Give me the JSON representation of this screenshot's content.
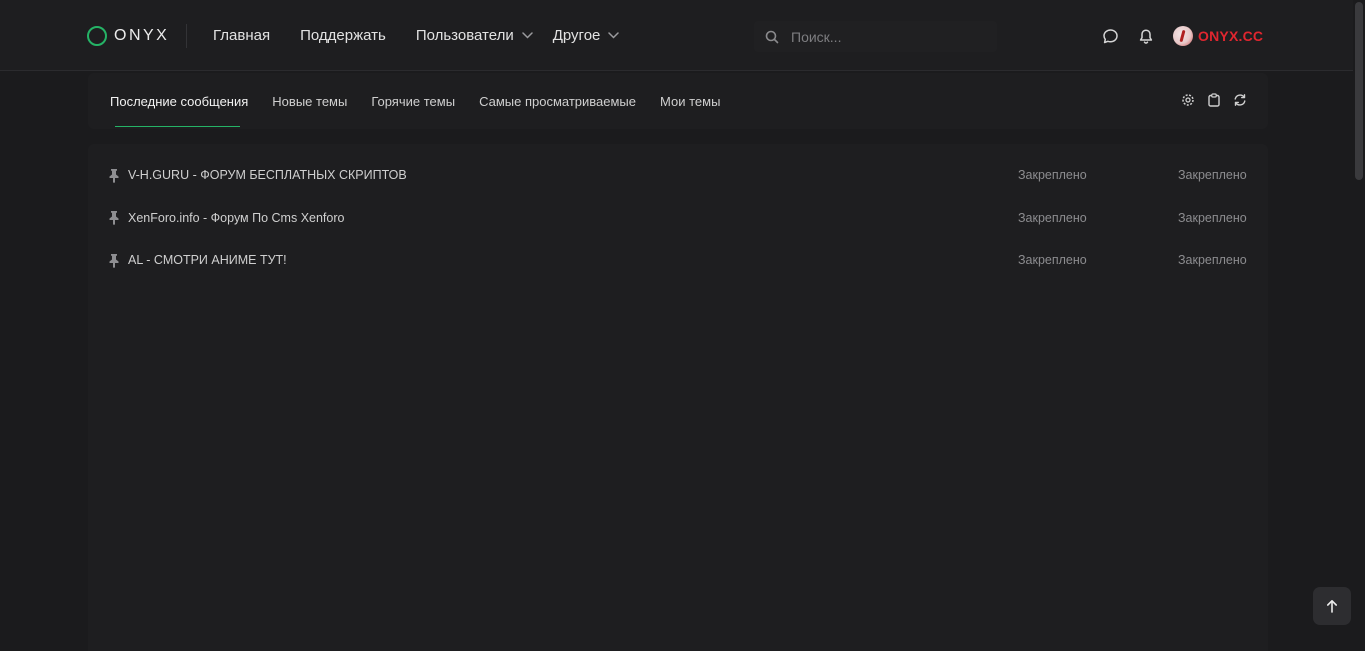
{
  "brand": {
    "name": "ONYX",
    "accent": "#25b366"
  },
  "nav": {
    "items": [
      {
        "label": "Главная",
        "dropdown": false
      },
      {
        "label": "Поддержать",
        "dropdown": false
      },
      {
        "label": "Пользователи",
        "dropdown": true
      },
      {
        "label": "Другое",
        "dropdown": true
      }
    ]
  },
  "search": {
    "placeholder": "Поиск...",
    "value": ""
  },
  "header_icons": [
    "chat-icon",
    "bell-icon"
  ],
  "user": {
    "name": "ONYX.CC",
    "color": "#e0262f"
  },
  "tabs": {
    "items": [
      {
        "label": "Последние сообщения",
        "active": true
      },
      {
        "label": "Новые темы",
        "active": false
      },
      {
        "label": "Горячие темы",
        "active": false
      },
      {
        "label": "Самые просматриваемые",
        "active": false
      },
      {
        "label": "Мои темы",
        "active": false
      }
    ],
    "actions": [
      "settings-icon",
      "clipboard-icon",
      "refresh-icon"
    ]
  },
  "threads": [
    {
      "title": "V-H.GURU - ФОРУМ БЕСПЛАТНЫХ СКРИПТОВ",
      "col1": "Закреплено",
      "col2": "Закреплено"
    },
    {
      "title": "XenForo.info - Форум По Cms Xenforo",
      "col1": "Закреплено",
      "col2": "Закреплено"
    },
    {
      "title": "AL - СМОТРИ АНИМЕ ТУТ!",
      "col1": "Закреплено",
      "col2": "Закреплено"
    }
  ]
}
